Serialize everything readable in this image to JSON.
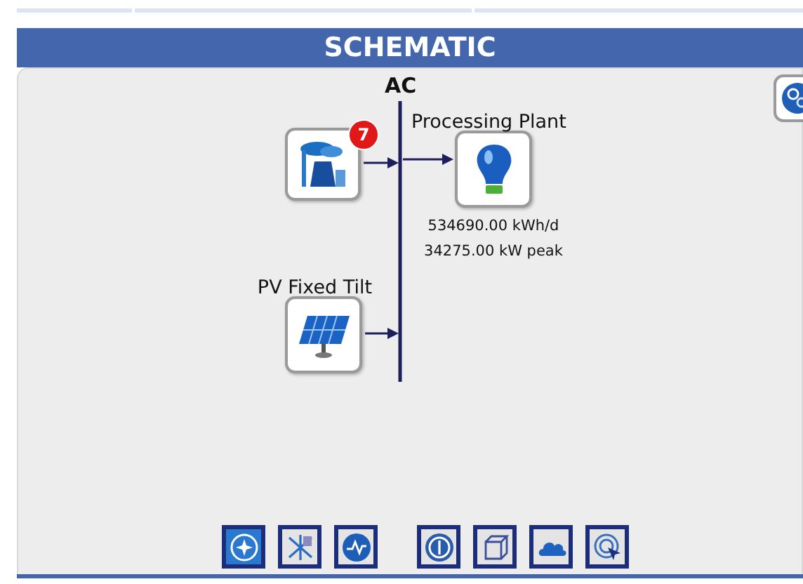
{
  "header": {
    "title": "SCHEMATIC"
  },
  "schematic": {
    "bus": {
      "label": "AC"
    },
    "components": [
      {
        "kind": "generator",
        "badge": "7"
      },
      {
        "kind": "load",
        "label": "Processing Plant",
        "readings": [
          "534690.00 kWh/d",
          "34275.00 kW peak"
        ]
      },
      {
        "kind": "pv",
        "label": "PV Fixed Tilt"
      }
    ]
  },
  "toolbar": [
    {
      "kind": "compass",
      "selected": true
    },
    {
      "kind": "sensitivity",
      "selected": false
    },
    {
      "kind": "waveform",
      "selected": false
    },
    {
      "kind": "dollar",
      "selected": false
    },
    {
      "kind": "cube",
      "selected": false
    },
    {
      "kind": "cloud",
      "selected": false
    },
    {
      "kind": "target",
      "selected": false
    }
  ]
}
